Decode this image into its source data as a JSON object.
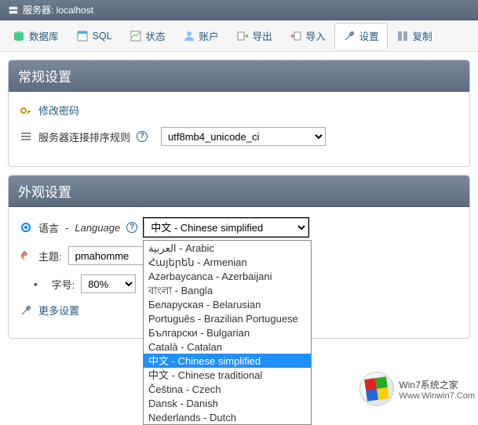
{
  "breadcrumb": {
    "label": "服务器: localhost"
  },
  "toolbar": {
    "database": "数据库",
    "sql": "SQL",
    "status": "状态",
    "accounts": "账户",
    "export": "导出",
    "import": "导入",
    "settings": "设置",
    "replicate": "复制"
  },
  "general": {
    "title": "常规设置",
    "change_pw": "修改密码",
    "collation_label": "服务器连接排序规则",
    "collation_value": "utf8mb4_unicode_ci"
  },
  "appearance": {
    "title": "外观设置",
    "language_label_zh": "语言",
    "language_label_en": "Language",
    "language_value": "中文 - Chinese simplified",
    "theme_label": "主题:",
    "theme_value": "pmahomme",
    "font_label": "字号:",
    "font_value": "80%",
    "more": "更多设置"
  },
  "lang_options": [
    "العربية - Arabic",
    "Հայերեն - Armenian",
    "Azərbaycanca - Azerbaijani",
    "বাংলা - Bangla",
    "Беларуская - Belarusian",
    "Português - Brazilian Portuguese",
    "Български - Bulgarian",
    "Català - Catalan",
    "中文 - Chinese simplified",
    "中文 - Chinese traditional",
    "Čeština - Czech",
    "Dansk - Danish",
    "Nederlands - Dutch"
  ],
  "lang_selected_index": 8,
  "watermark": {
    "line1": "Win7系统之家",
    "line2": "Www.Winwin7.Com"
  }
}
